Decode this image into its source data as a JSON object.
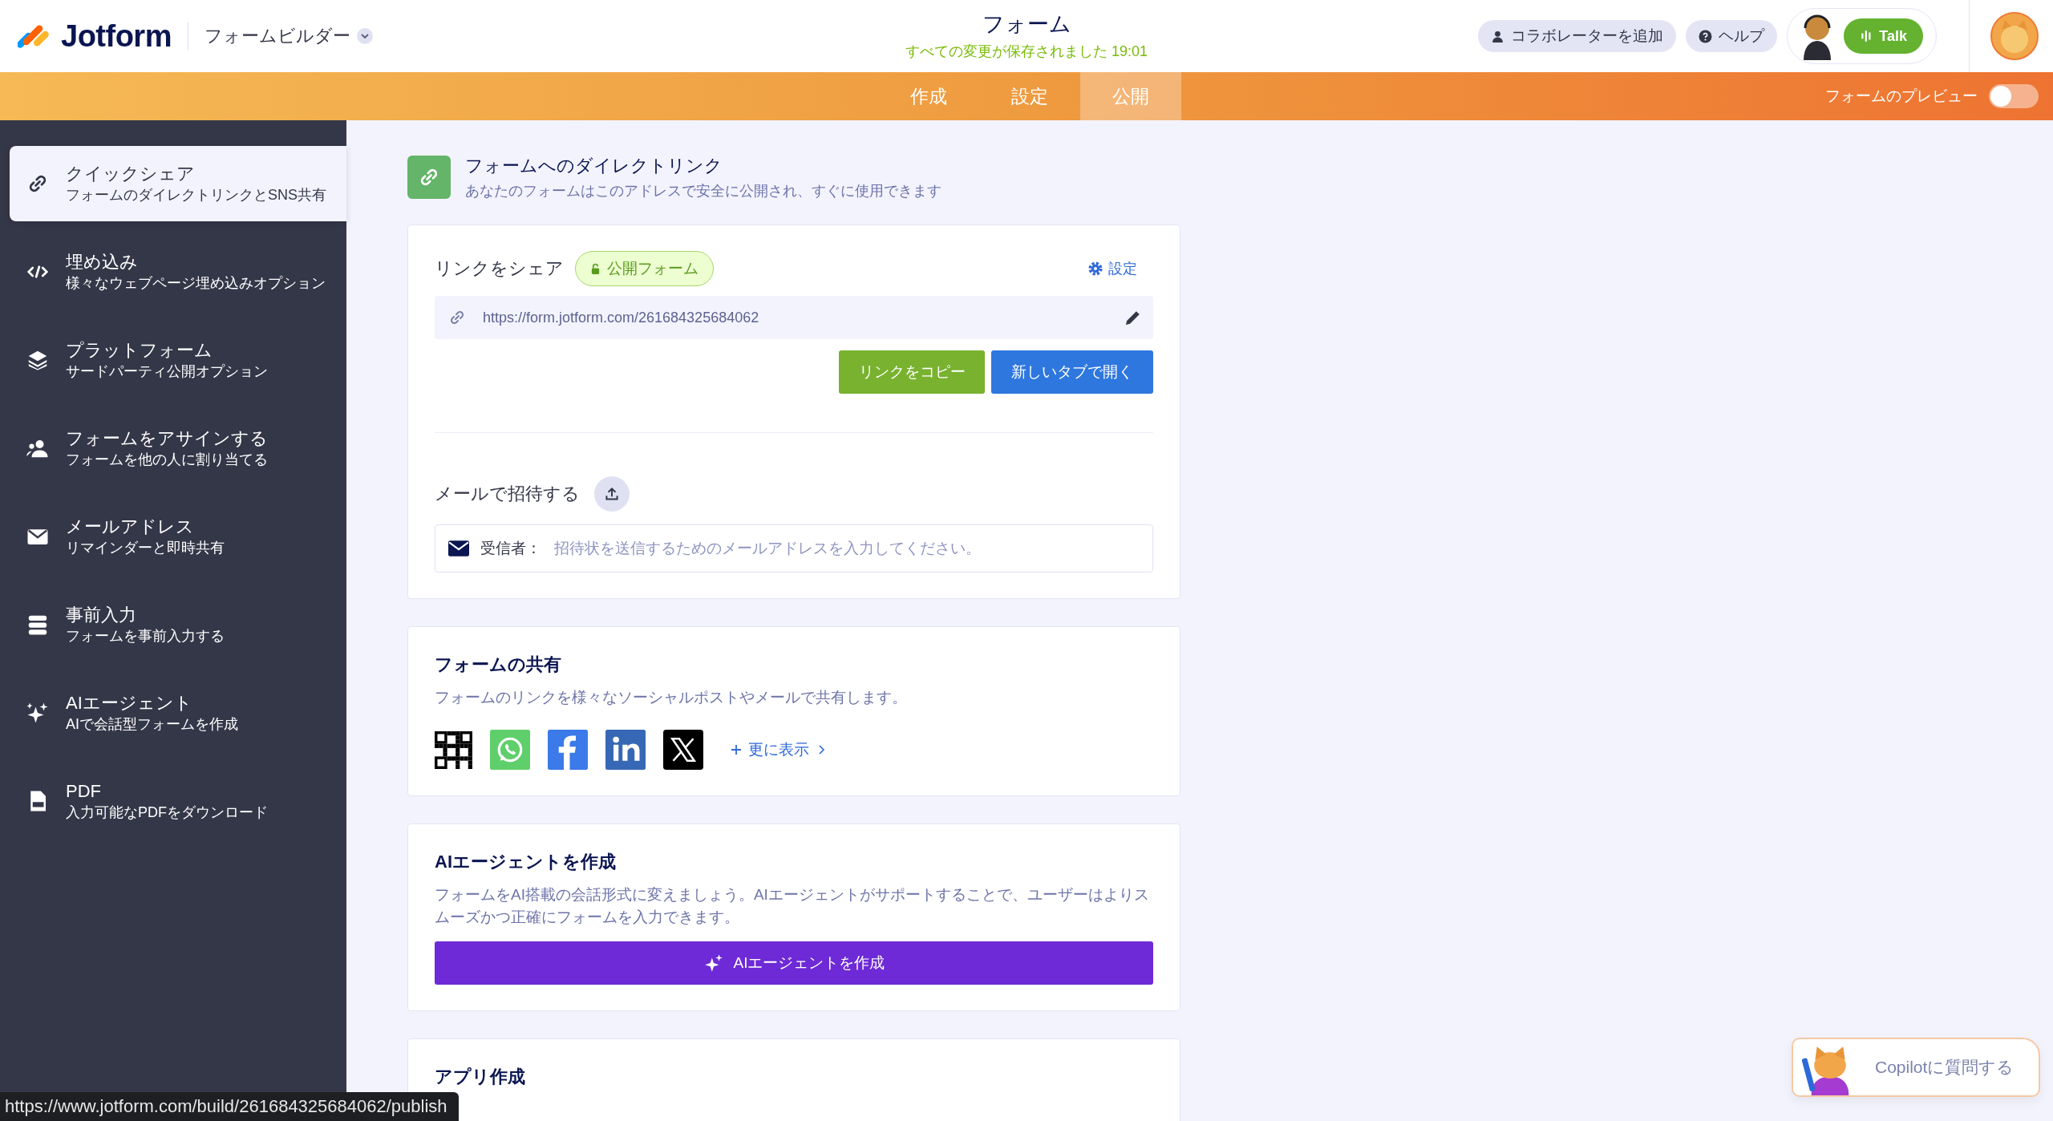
{
  "header": {
    "logo": "Jotform",
    "builder_menu": "フォームビルダー",
    "title": "フォーム",
    "saved_status": "すべての変更が保存されました",
    "saved_time": "19:01",
    "buttons": [
      {
        "label": "コラボレーターを追加",
        "kind": "collab"
      },
      {
        "label": "ヘルプ",
        "kind": "help"
      }
    ],
    "talk": "Talk"
  },
  "tabs": [
    {
      "label": "作成",
      "selected": false
    },
    {
      "label": "設定",
      "selected": false
    },
    {
      "label": "公開",
      "selected": true
    }
  ],
  "preview": {
    "label": "フォームのプレビュー",
    "on": false
  },
  "sidebar": {
    "items": [
      {
        "kind": "link",
        "title": "クイックシェア",
        "subtitle": "フォームのダイレクトリンクとSNS共有",
        "selected": true
      },
      {
        "kind": "embed",
        "title": "埋め込み",
        "subtitle": "様々なウェブページ埋め込みオプション",
        "selected": false
      },
      {
        "kind": "layers",
        "title": "プラットフォーム",
        "subtitle": "サードパーティ公開オプション",
        "selected": false
      },
      {
        "kind": "users",
        "title": "フォームをアサインする",
        "subtitle": "フォームを他の人に割り当てる",
        "selected": false
      },
      {
        "kind": "mail",
        "title": "メールアドレス",
        "subtitle": "リマインダーと即時共有",
        "selected": false
      },
      {
        "kind": "prefill",
        "title": "事前入力",
        "subtitle": "フォームを事前入力する",
        "selected": false
      },
      {
        "kind": "sparkle",
        "title": "AIエージェント",
        "subtitle": "AIで会話型フォームを作成",
        "selected": false
      },
      {
        "kind": "pdf",
        "title": "PDF",
        "subtitle": "入力可能なPDFをダウンロード",
        "selected": false
      }
    ]
  },
  "direct_link": {
    "title": "フォームへのダイレクトリンク",
    "description": "あなたのフォームはこのアドレスで安全に公開され、すぐに使用できます"
  },
  "share_link": {
    "title": "リンクをシェア",
    "badge": "公開フォーム",
    "settings": "設定",
    "url": "https://form.jotform.com/261684325684062",
    "copy_button": "リンクをコピー",
    "open_button": "新しいタブで開く"
  },
  "invite": {
    "title": "メールで招待する",
    "recipient_label": "受信者：",
    "placeholder": "招待状を送信するためのメールアドレスを入力してください。"
  },
  "social_share": {
    "title": "フォームの共有",
    "description": "フォームのリンクを様々なソーシャルポストやメールで共有します。",
    "networks": [
      {
        "kind": "qr"
      },
      {
        "kind": "whatsapp"
      },
      {
        "kind": "facebook"
      },
      {
        "kind": "linkedin"
      },
      {
        "kind": "x"
      }
    ],
    "more": "更に表示"
  },
  "ai_agent": {
    "title": "AIエージェントを作成",
    "description": "フォームをAI搭載の会話形式に変えましょう。AIエージェントがサポートすることで、ユーザーはよりスムーズかつ正確にフォームを入力できます。",
    "button": "AIエージェントを作成"
  },
  "app_card": {
    "title": "アプリ作成"
  },
  "copilot": {
    "label": "Copilotに質問する"
  },
  "status_url": "https://www.jotform.com/build/261684325684062/publish"
}
